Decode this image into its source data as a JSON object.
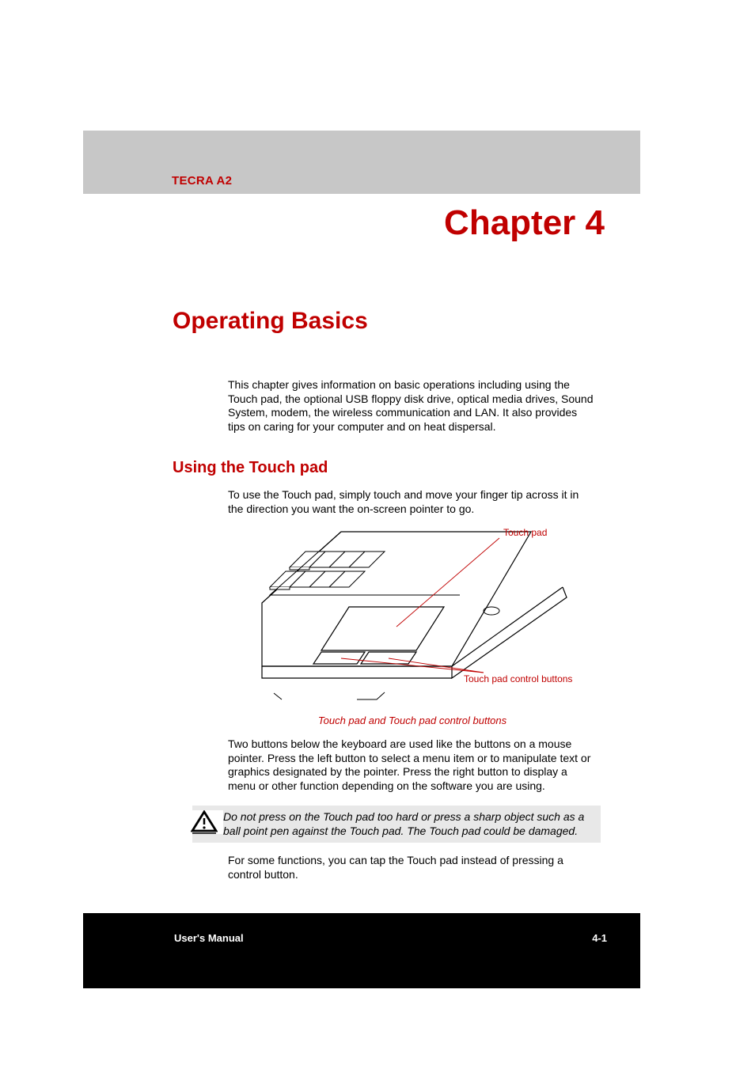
{
  "header": {
    "product": "TECRA A2"
  },
  "chapter": {
    "title": "Chapter 4"
  },
  "section": {
    "title": "Operating Basics",
    "intro": "This chapter gives information on basic operations including using the Touch pad, the optional USB floppy disk drive, optical media drives, Sound System, modem, the wireless communication and LAN. It also provides tips on caring for your computer and on heat dispersal."
  },
  "subsection": {
    "title": "Using the Touch pad",
    "para1": "To use the Touch pad, simply touch and move your finger tip across it in the direction you want the on-screen pointer to go.",
    "para2": "Two buttons below the keyboard are used like the buttons on a mouse pointer. Press the left button to select a menu item or to manipulate text or graphics designated by the pointer. Press the right button to display a menu or other function depending on the software you are using.",
    "caution": "Do not press on the Touch pad too hard or press a sharp object such as a ball point pen against the Touch pad. The Touch pad could be damaged.",
    "para3": "For some functions, you can tap the Touch pad instead of pressing a control button."
  },
  "figure": {
    "label_touchpad": "Touch pad",
    "label_buttons": "Touch pad control buttons",
    "caption": "Touch pad and Touch pad control buttons"
  },
  "footer": {
    "left": "User's Manual",
    "right": "4-1"
  }
}
